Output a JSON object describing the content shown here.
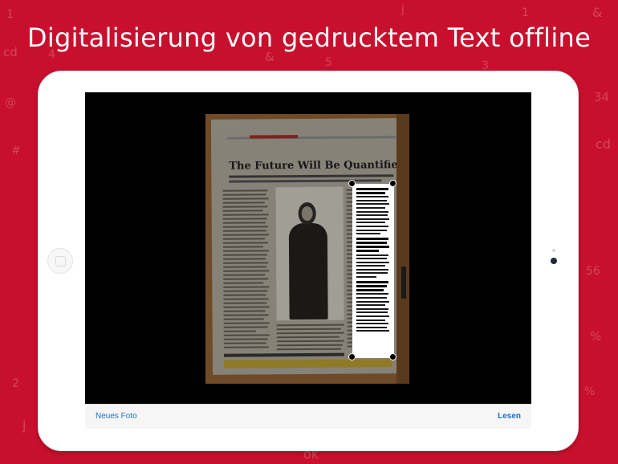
{
  "headline": "Digitalisierung von gedrucktem Text offline",
  "background_glyphs": [
    "&",
    "1",
    "cd",
    "3",
    "34",
    "5",
    "j",
    "1",
    "&",
    "#",
    "4",
    "cd",
    "j",
    "ok",
    "%",
    "@",
    "56",
    "2",
    "2",
    "%"
  ],
  "app": {
    "toolbar": {
      "left_label": "Neues Foto",
      "right_label": "Lesen"
    }
  },
  "document": {
    "headline": "The Future Will Be Quantified"
  },
  "colors": {
    "background": "#c8102e",
    "accent": "#1a6fd4",
    "device": "#ffffff"
  }
}
